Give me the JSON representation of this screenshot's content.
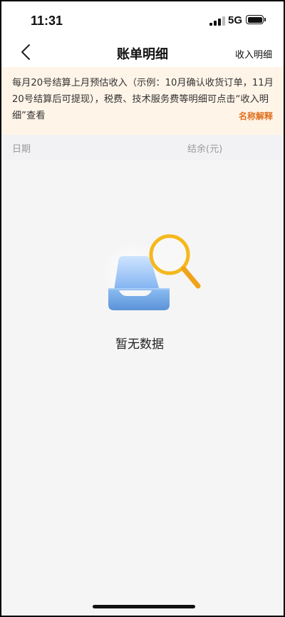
{
  "status_bar": {
    "time": "11:31",
    "network": "5G"
  },
  "nav": {
    "title": "账单明细",
    "right_action": "收入明细",
    "back_icon": "chevron-left-icon"
  },
  "notice": {
    "text": "每月20号结算上月预估收入（示例：10月确认收货订单，11月20号结算后可提现），税费、技术服务费等明细可点击“收入明细”查看",
    "link_label": "名称解释",
    "background": "#fff4e8",
    "link_color": "#e0701e"
  },
  "columns": {
    "date": "日期",
    "balance": "结余(元)"
  },
  "empty_state": {
    "text": "暂无数据",
    "icon": "empty-tray-magnifier-icon"
  },
  "colors": {
    "accent_orange": "#e0701e",
    "magnifier_yellow": "#f5b81c",
    "tray_blue": "#6fa6e6"
  }
}
